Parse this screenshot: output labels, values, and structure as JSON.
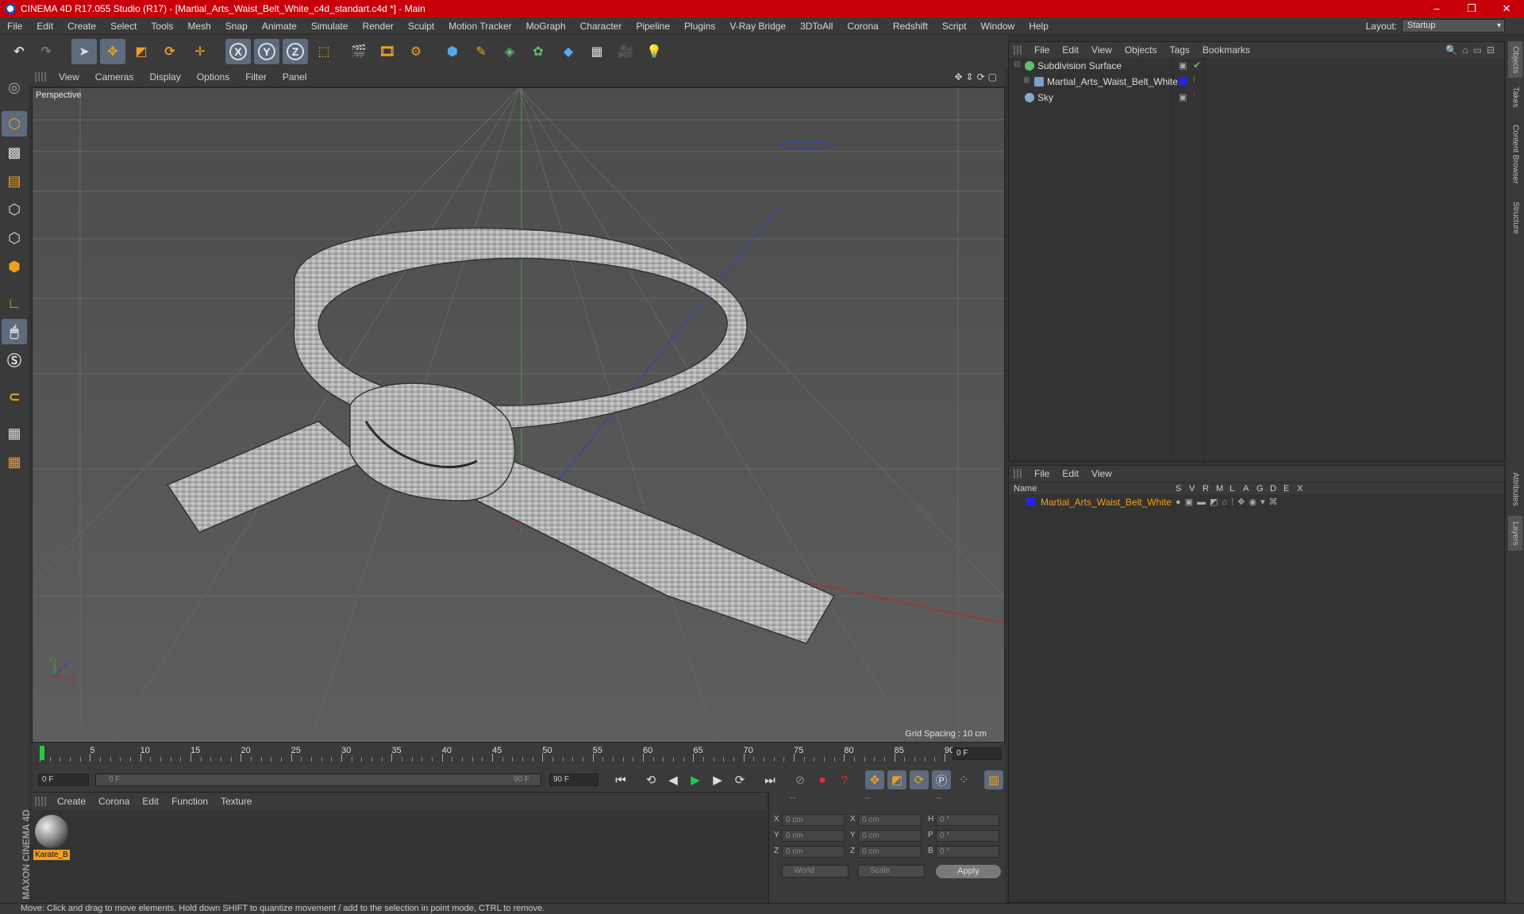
{
  "window": {
    "title": "CINEMA 4D R17.055 Studio (R17) - [Martial_Arts_Waist_Belt_White_c4d_standart.c4d *] - Main",
    "controls": [
      "–",
      "❐",
      "✕"
    ]
  },
  "menu": [
    "File",
    "Edit",
    "Create",
    "Select",
    "Tools",
    "Mesh",
    "Snap",
    "Animate",
    "Simulate",
    "Render",
    "Sculpt",
    "Motion Tracker",
    "MoGraph",
    "Character",
    "Pipeline",
    "Plugins",
    "V-Ray Bridge",
    "3DToAll",
    "Corona",
    "Redshift",
    "Script",
    "Window",
    "Help"
  ],
  "layout": {
    "label": "Layout:",
    "value": "Startup"
  },
  "toolbar": {
    "axis_x": "X",
    "axis_y": "Y",
    "axis_z": "Z"
  },
  "viewport": {
    "menu": [
      "View",
      "Cameras",
      "Display",
      "Options",
      "Filter",
      "Panel"
    ],
    "label": "Perspective",
    "grid_spacing": "Grid Spacing : 10 cm",
    "axis_x": "X",
    "axis_y": "Y",
    "axis_z": "Z"
  },
  "timeline": {
    "ticks": [
      "0",
      "5",
      "10",
      "15",
      "20",
      "25",
      "30",
      "35",
      "40",
      "45",
      "50",
      "55",
      "60",
      "65",
      "70",
      "75",
      "80",
      "85",
      "90"
    ],
    "current_frame": "0 F"
  },
  "transport": {
    "start": "0 F",
    "range_start": "0 F",
    "range_end": "90 F",
    "end": "90 F"
  },
  "material_manager": {
    "menu": [
      "Create",
      "Corona",
      "Edit",
      "Function",
      "Texture"
    ],
    "material_name": "Karate_B"
  },
  "coordinates": {
    "headers": [
      "--",
      "--",
      "--"
    ],
    "rows": [
      {
        "a": "X",
        "pos": "0 cm",
        "b": "X",
        "size": "0 cm",
        "c": "H",
        "rot": "0 °"
      },
      {
        "a": "Y",
        "pos": "0 cm",
        "b": "Y",
        "size": "0 cm",
        "c": "P",
        "rot": "0 °"
      },
      {
        "a": "Z",
        "pos": "0 cm",
        "b": "Z",
        "size": "0 cm",
        "c": "B",
        "rot": "0 °"
      }
    ],
    "mode": "World",
    "scale": "Scale",
    "apply": "Apply"
  },
  "object_manager": {
    "menu": [
      "File",
      "Edit",
      "View",
      "Objects",
      "Tags",
      "Bookmarks"
    ],
    "objects": [
      {
        "name": "Subdivision Surface",
        "icon_color": "#5ec06a"
      },
      {
        "name": "Martial_Arts_Waist_Belt_White",
        "icon_color": "#7aa0d0"
      },
      {
        "name": "Sky",
        "icon_color": "#8aa8c8"
      }
    ]
  },
  "layer_manager": {
    "menu": [
      "File",
      "Edit",
      "View"
    ],
    "columns": [
      "Name",
      "S",
      "V",
      "R",
      "M",
      "L",
      "A",
      "G",
      "D",
      "E",
      "X"
    ],
    "layer_name": "Martial_Arts_Waist_Belt_White",
    "layer_color": "#2424e6"
  },
  "right_tabs": [
    "Objects",
    "Takes",
    "Content Browser",
    "Structure",
    "Attributes",
    "Layers"
  ],
  "status": "Move: Click and drag to move elements. Hold down SHIFT to quantize movement / add to the selection in point mode, CTRL to remove.",
  "branding": "MAXON CINEMA 4D",
  "colors": {
    "titlebar": "#c8000a",
    "accent": "#f0a020",
    "selection": "#5d6b7c"
  }
}
